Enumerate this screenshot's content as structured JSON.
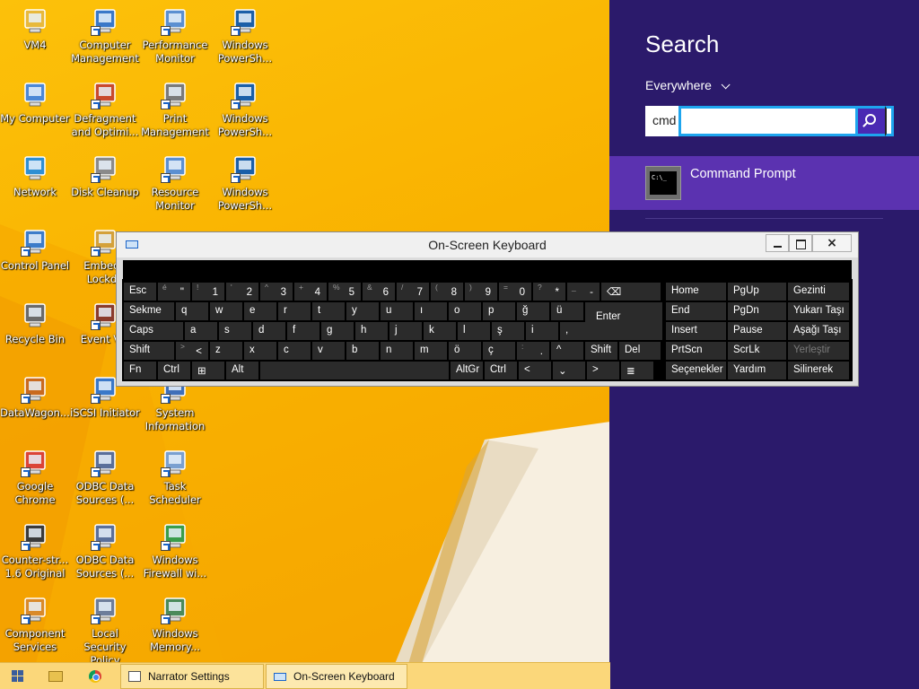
{
  "desktop": {
    "icons": [
      {
        "id": "vm4",
        "label": "VM4",
        "icon": "folder-icon"
      },
      {
        "id": "computer-management",
        "label": "Computer\nManagement",
        "icon": "computer-management-icon"
      },
      {
        "id": "performance-monitor",
        "label": "Performance\nMonitor",
        "icon": "performance-monitor-icon"
      },
      {
        "id": "windows-powershell-1",
        "label": "Windows\nPowerSh...",
        "icon": "powershell-icon"
      },
      {
        "id": "my-computer",
        "label": "My Computer",
        "icon": "computer-icon"
      },
      {
        "id": "defragment",
        "label": "Defragment\nand Optimi...",
        "icon": "defrag-icon"
      },
      {
        "id": "print-management",
        "label": "Print\nManagement",
        "icon": "printer-icon"
      },
      {
        "id": "windows-powershell-2",
        "label": "Windows\nPowerSh...",
        "icon": "powershell-icon"
      },
      {
        "id": "network",
        "label": "Network",
        "icon": "network-globe-icon"
      },
      {
        "id": "disk-cleanup",
        "label": "Disk Cleanup",
        "icon": "disk-cleanup-icon"
      },
      {
        "id": "resource-monitor",
        "label": "Resource\nMonitor",
        "icon": "resource-monitor-icon"
      },
      {
        "id": "windows-powershell-3",
        "label": "Windows\nPowerSh...",
        "icon": "powershell-icon"
      },
      {
        "id": "control-panel",
        "label": "Control Panel",
        "icon": "control-panel-icon"
      },
      {
        "id": "embedded-lockdown",
        "label": "Embedd\nLockdo",
        "icon": "lock-icon"
      },
      {
        "id": "recycle-bin",
        "label": "Recycle Bin",
        "icon": "recycle-bin-icon"
      },
      {
        "id": "event-viewer",
        "label": "Event Vie",
        "icon": "event-viewer-icon"
      },
      {
        "id": "datawagon",
        "label": "DataWagon...",
        "icon": "datawagon-icon"
      },
      {
        "id": "iscsi-initiator",
        "label": "iSCSI Initiator",
        "icon": "iscsi-icon"
      },
      {
        "id": "system-information",
        "label": "System\nInformation",
        "icon": "system-info-icon"
      },
      {
        "id": "google-chrome",
        "label": "Google\nChrome",
        "icon": "chrome-icon"
      },
      {
        "id": "odbc-data-sources-1",
        "label": "ODBC Data\nSources (...",
        "icon": "odbc-icon"
      },
      {
        "id": "task-scheduler",
        "label": "Task\nScheduler",
        "icon": "clock-icon"
      },
      {
        "id": "counter-strike",
        "label": "Counter-str...\n1.6 Original",
        "icon": "counter-strike-icon"
      },
      {
        "id": "odbc-data-sources-2",
        "label": "ODBC Data\nSources (...",
        "icon": "odbc-icon"
      },
      {
        "id": "windows-firewall",
        "label": "Windows\nFirewall wi...",
        "icon": "firewall-icon"
      },
      {
        "id": "component-services",
        "label": "Component\nServices",
        "icon": "component-services-icon"
      },
      {
        "id": "local-security-policy",
        "label": "Local Security\nPolicy",
        "icon": "security-policy-icon"
      },
      {
        "id": "windows-memory",
        "label": "Windows\nMemory...",
        "icon": "memory-diagnostic-icon"
      }
    ]
  },
  "search": {
    "title": "Search",
    "scope": "Everywhere",
    "query": "cmd",
    "results": [
      {
        "label": "Command Prompt",
        "icon": "command-prompt-icon"
      }
    ]
  },
  "osk": {
    "title": "On-Screen Keyboard",
    "close_label": "×",
    "rows": [
      [
        {
          "p": "Esc"
        },
        {
          "p": "\"",
          "s": "é"
        },
        {
          "p": "1",
          "s": "!"
        },
        {
          "p": "2",
          "s": "'"
        },
        {
          "p": "3",
          "s": "^"
        },
        {
          "p": "4",
          "s": "+"
        },
        {
          "p": "5",
          "s": "%"
        },
        {
          "p": "6",
          "s": "&"
        },
        {
          "p": "7",
          "s": "/"
        },
        {
          "p": "8",
          "s": "("
        },
        {
          "p": "9",
          "s": ")"
        },
        {
          "p": "0",
          "s": "="
        },
        {
          "p": "*",
          "s": "?"
        },
        {
          "p": "-",
          "s": "_"
        },
        {
          "p": "⌫"
        }
      ],
      [
        {
          "p": "Sekme"
        },
        {
          "p": "q"
        },
        {
          "p": "w"
        },
        {
          "p": "e"
        },
        {
          "p": "r"
        },
        {
          "p": "t"
        },
        {
          "p": "y"
        },
        {
          "p": "u"
        },
        {
          "p": "ı"
        },
        {
          "p": "o"
        },
        {
          "p": "p"
        },
        {
          "p": "ğ"
        },
        {
          "p": "ü"
        },
        {
          "p": "Enter"
        }
      ],
      [
        {
          "p": "Caps"
        },
        {
          "p": "a"
        },
        {
          "p": "s"
        },
        {
          "p": "d"
        },
        {
          "p": "f"
        },
        {
          "p": "g"
        },
        {
          "p": "h"
        },
        {
          "p": "j"
        },
        {
          "p": "k"
        },
        {
          "p": "l"
        },
        {
          "p": "ş"
        },
        {
          "p": "i"
        },
        {
          "p": ","
        }
      ],
      [
        {
          "p": "Shift"
        },
        {
          "p": "<",
          "s": ">"
        },
        {
          "p": "z"
        },
        {
          "p": "x"
        },
        {
          "p": "c"
        },
        {
          "p": "v"
        },
        {
          "p": "b"
        },
        {
          "p": "n"
        },
        {
          "p": "m"
        },
        {
          "p": "ö"
        },
        {
          "p": "ç"
        },
        {
          "p": ".",
          "s": ":"
        },
        {
          "p": "^"
        },
        {
          "p": "Shift"
        },
        {
          "p": "Del"
        }
      ],
      [
        {
          "p": "Fn"
        },
        {
          "p": "Ctrl"
        },
        {
          "p": "⊞"
        },
        {
          "p": "Alt"
        },
        {
          "p": ""
        },
        {
          "p": "AltGr"
        },
        {
          "p": "Ctrl"
        },
        {
          "p": "<"
        },
        {
          "p": "⌄"
        },
        {
          "p": ">"
        },
        {
          "p": "≣"
        }
      ]
    ],
    "nav_keys": [
      [
        "Home",
        "PgUp",
        "Gezinti"
      ],
      [
        "End",
        "PgDn",
        "Yukarı Taşı"
      ],
      [
        "Insert",
        "Pause",
        "Aşağı Taşı"
      ],
      [
        "PrtScn",
        "ScrLk",
        "Yerleştir"
      ],
      [
        "Seçenekler",
        "Yardım",
        "Silinerek"
      ]
    ]
  },
  "taskbar": {
    "tasks": [
      {
        "label": "Narrator Settings",
        "icon": "narrator-icon"
      },
      {
        "label": "On-Screen Keyboard",
        "icon": "keyboard-icon"
      }
    ]
  },
  "colors": {
    "search_panel_bg": "#2b1a6b",
    "search_result_bg": "#5b32b0",
    "search_accent": "#1ea5ee",
    "wallpaper": "#f6b400"
  }
}
